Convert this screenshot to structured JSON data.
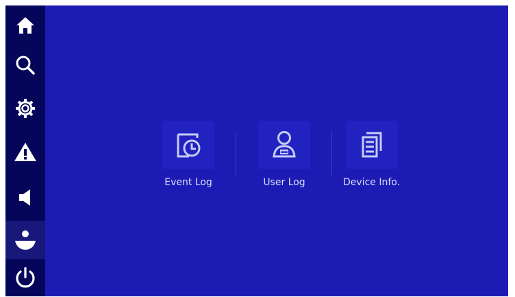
{
  "sidebar": {
    "items": [
      {
        "name": "home",
        "icon": "home-icon"
      },
      {
        "name": "search",
        "icon": "search-icon"
      },
      {
        "name": "settings",
        "icon": "gear-icon"
      },
      {
        "name": "alarm",
        "icon": "warning-icon"
      },
      {
        "name": "sound",
        "icon": "speaker-icon"
      },
      {
        "name": "user",
        "icon": "user-icon",
        "active": true
      },
      {
        "name": "power",
        "icon": "power-icon"
      }
    ]
  },
  "main": {
    "items": [
      {
        "label": "Event Log",
        "icon": "event-log-icon"
      },
      {
        "label": "User Log",
        "icon": "user-log-icon"
      },
      {
        "label": "Device Info.",
        "icon": "device-info-icon"
      }
    ]
  },
  "colors": {
    "background": "#1c1cb5",
    "sidebar": "#05055a",
    "sidebar_active": "#18187a",
    "icon_tile": "#2222c0",
    "label": "#d9defc"
  }
}
